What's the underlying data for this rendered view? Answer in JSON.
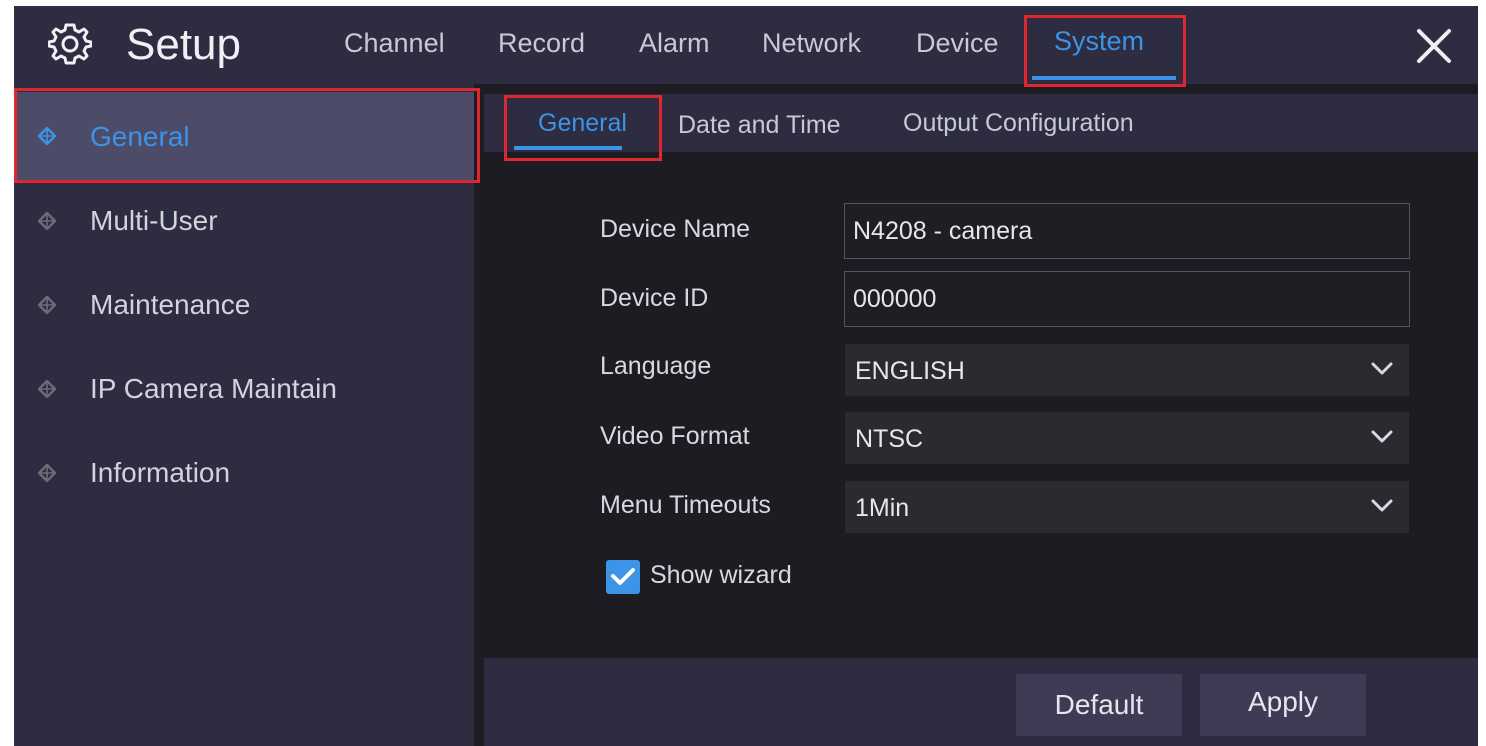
{
  "header": {
    "title": "Setup",
    "tabs": [
      {
        "label": "Channel"
      },
      {
        "label": "Record"
      },
      {
        "label": "Alarm"
      },
      {
        "label": "Network"
      },
      {
        "label": "Device"
      },
      {
        "label": "System"
      }
    ],
    "active_tab": "System",
    "icons": {
      "setup": "gear-icon",
      "close": "close-icon"
    }
  },
  "sidebar": {
    "items": [
      {
        "label": "General"
      },
      {
        "label": "Multi-User"
      },
      {
        "label": "Maintenance"
      },
      {
        "label": "IP Camera Maintain"
      },
      {
        "label": "Information"
      }
    ],
    "active_item": "General",
    "icon": "diamond-icon"
  },
  "subtabs": {
    "items": [
      {
        "label": "General"
      },
      {
        "label": "Date and Time"
      },
      {
        "label": "Output Configuration"
      }
    ],
    "active": "General"
  },
  "form": {
    "device_name": {
      "label": "Device Name",
      "value": "N4208 - camera"
    },
    "device_id": {
      "label": "Device ID",
      "value": "000000"
    },
    "language": {
      "label": "Language",
      "value": "ENGLISH"
    },
    "video_format": {
      "label": "Video Format",
      "value": "NTSC"
    },
    "menu_timeouts": {
      "label": "Menu Timeouts",
      "value": "1Min"
    },
    "show_wizard": {
      "label": "Show wizard",
      "checked": true
    }
  },
  "footer": {
    "default_label": "Default",
    "apply_label": "Apply"
  },
  "colors": {
    "accent": "#3d93e6",
    "highlight_box": "#e0262e",
    "panel_bg": "#2d2c41",
    "content_bg": "#1c1c22"
  }
}
